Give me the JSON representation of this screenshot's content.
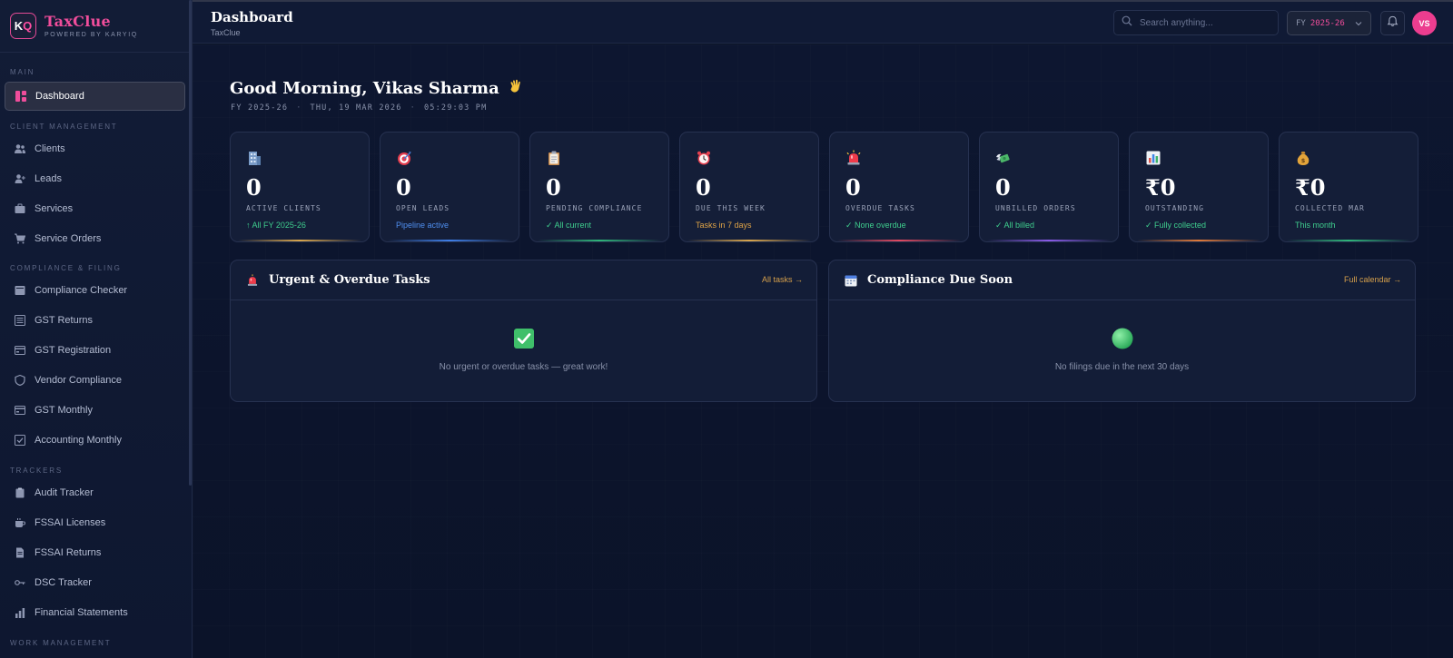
{
  "brand": {
    "logo_k": "K",
    "logo_q": "Q",
    "name": "TaxClue",
    "tagline": "POWERED BY KARYIQ"
  },
  "sidebar": {
    "sections": [
      {
        "label": "MAIN",
        "items": [
          {
            "label": "Dashboard",
            "icon": "dashboard-icon",
            "active": true
          }
        ]
      },
      {
        "label": "CLIENT MANAGEMENT",
        "items": [
          {
            "label": "Clients",
            "icon": "users-icon"
          },
          {
            "label": "Leads",
            "icon": "user-plus-icon"
          },
          {
            "label": "Services",
            "icon": "briefcase-icon"
          },
          {
            "label": "Service Orders",
            "icon": "cart-icon"
          }
        ]
      },
      {
        "label": "COMPLIANCE & FILING",
        "items": [
          {
            "label": "Compliance Checker",
            "icon": "inbox-icon"
          },
          {
            "label": "GST Returns",
            "icon": "list-icon"
          },
          {
            "label": "GST Registration",
            "icon": "card-icon"
          },
          {
            "label": "Vendor Compliance",
            "icon": "shield-icon"
          },
          {
            "label": "GST Monthly",
            "icon": "card-icon"
          },
          {
            "label": "Accounting Monthly",
            "icon": "checkbox-icon"
          }
        ]
      },
      {
        "label": "TRACKERS",
        "items": [
          {
            "label": "Audit Tracker",
            "icon": "clipboard-icon"
          },
          {
            "label": "FSSAI Licenses",
            "icon": "cup-icon"
          },
          {
            "label": "FSSAI Returns",
            "icon": "file-icon"
          },
          {
            "label": "DSC Tracker",
            "icon": "key-icon"
          },
          {
            "label": "Financial Statements",
            "icon": "bar-chart-icon"
          }
        ]
      },
      {
        "label": "WORK MANAGEMENT",
        "items": []
      }
    ]
  },
  "header": {
    "title": "Dashboard",
    "crumb": "TaxClue",
    "search_placeholder": "Search anything...",
    "fy_label": "FY",
    "fy_value": "2025-26",
    "avatar_initials": "VS"
  },
  "greeting": {
    "text": "Good Morning, Vikas Sharma",
    "fy": "FY 2025-26",
    "date": "THU, 19 MAR 2026",
    "time": "05:29:03 PM"
  },
  "stats": [
    {
      "icon": "building-icon",
      "value": "0",
      "label": "ACTIVE CLIENTS",
      "sub": "↑ All FY 2025-26",
      "sub_color": "#3fcf8e",
      "bar": "#d9a64e"
    },
    {
      "icon": "target-icon",
      "value": "0",
      "label": "OPEN LEADS",
      "sub": "Pipeline active",
      "sub_color": "#4f8ff0",
      "bar": "#3f7fe8"
    },
    {
      "icon": "clipboard-icon",
      "value": "0",
      "label": "PENDING COMPLIANCE",
      "sub": "✓ All current",
      "sub_color": "#3fcf8e",
      "bar": "#2fb57a"
    },
    {
      "icon": "alarm-clock-icon",
      "value": "0",
      "label": "DUE THIS WEEK",
      "sub": "Tasks in 7 days",
      "sub_color": "#e0a447",
      "bar": "#d9a64e"
    },
    {
      "icon": "siren-icon",
      "value": "0",
      "label": "OVERDUE TASKS",
      "sub": "✓ None overdue",
      "sub_color": "#3fcf8e",
      "bar": "#e24a62"
    },
    {
      "icon": "money-wings-icon",
      "value": "0",
      "label": "UNBILLED ORDERS",
      "sub": "✓ All billed",
      "sub_color": "#3fcf8e",
      "bar": "#8a5be8"
    },
    {
      "icon": "bar-chart-icon",
      "value": "₹0",
      "label": "OUTSTANDING",
      "sub": "✓ Fully collected",
      "sub_color": "#3fcf8e",
      "bar": "#e07a3a"
    },
    {
      "icon": "money-bag-icon",
      "value": "₹0",
      "label": "COLLECTED MAR",
      "sub": "This month",
      "sub_color": "#3fcf8e",
      "bar": "#2fb57a"
    }
  ],
  "panels": [
    {
      "title": "Urgent & Overdue Tasks",
      "icon": "siren-icon",
      "link": "All tasks →",
      "empty_icon": "check-box-icon",
      "empty_text": "No urgent or overdue tasks — great work!"
    },
    {
      "title": "Compliance Due Soon",
      "icon": "calendar-icon",
      "link": "Full calendar →",
      "empty_icon": "green-circle-icon",
      "empty_text": "No filings due in the next 30 days"
    }
  ]
}
